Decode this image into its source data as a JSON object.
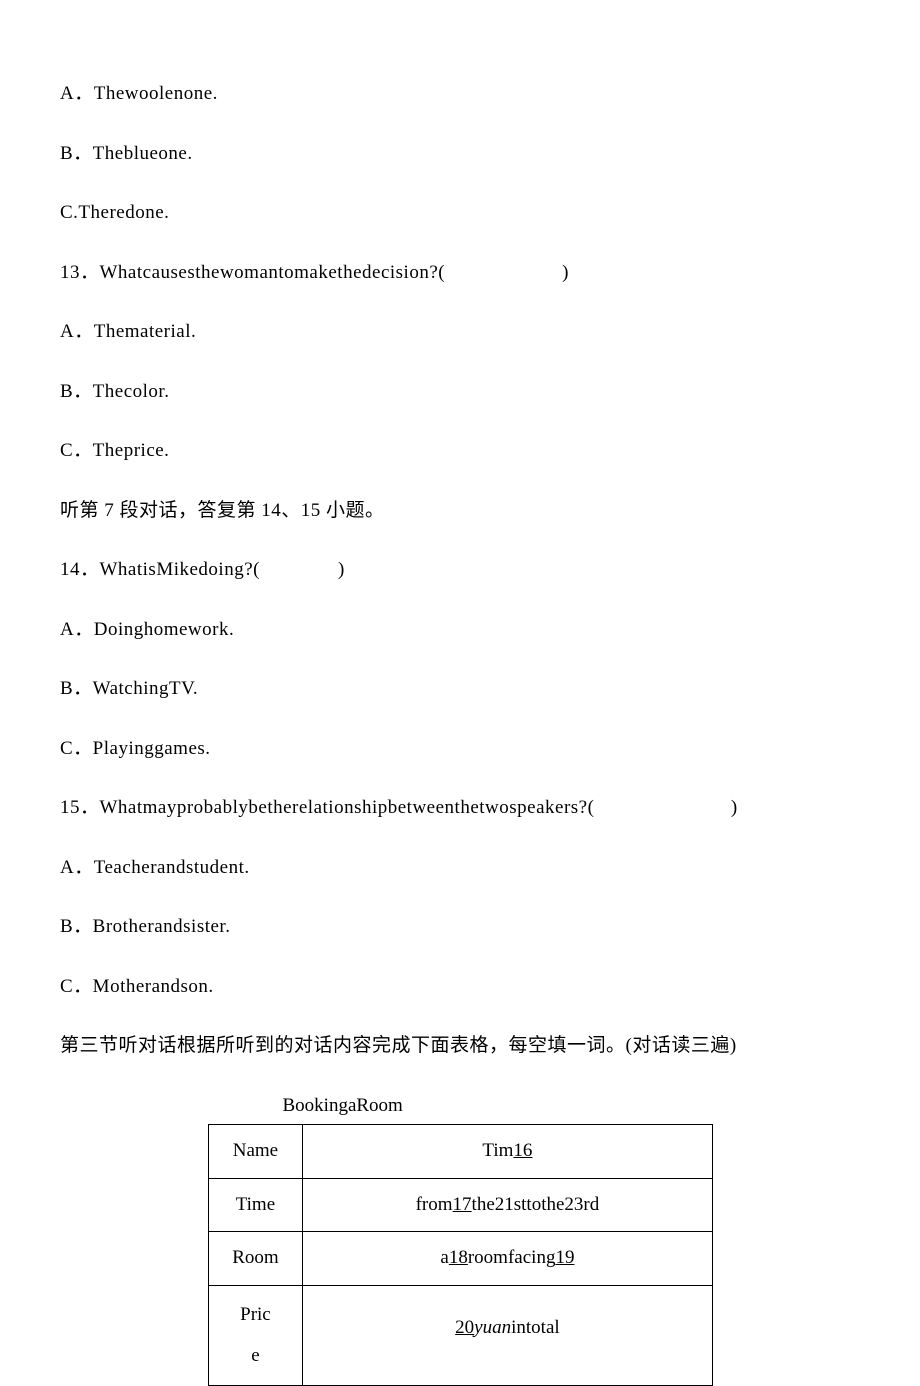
{
  "q12": {
    "optA": "A．Thewoolenone.",
    "optB": "B．Theblueone.",
    "optC": "C.Theredone."
  },
  "q13": {
    "prompt": "13．Whatcausesthewomantomakethedecision?(　　　　　　)",
    "optA": "A．Thematerial.",
    "optB": "B．Thecolor.",
    "optC": "C．Theprice."
  },
  "instruction7": "听第 7 段对话，答复第 14、15 小题。",
  "q14": {
    "prompt": "14．WhatisMikedoing?(　　　　)",
    "optA": "A．Doinghomework.",
    "optB": "B．WatchingTV.",
    "optC": "C．Playinggames."
  },
  "q15": {
    "prompt": "15．Whatmayprobablybetherelationshipbetweenthetwospeakers?(　　　　　　　)",
    "optA": "A．Teacherandstudent.",
    "optB": "B．Brotherandsister.",
    "optC": "C．Motherandson."
  },
  "section3_instruction": "第三节听对话根据所听到的对话内容完成下面表格，每空填一词。(对话读三遍)",
  "table": {
    "title": "BookingaRoom",
    "name_label": "Name",
    "name_prefix": "Tim",
    "name_blank": "16",
    "time_label": "Time",
    "time_prefix": "from",
    "time_blank": "17",
    "time_suffix": "the21sttothe23rd",
    "room_label": "Room",
    "room_prefix": "a",
    "room_blank1": "18",
    "room_mid": "roomfacing",
    "room_blank2": "19",
    "price_label": "Pric\ne",
    "price_blank": "20",
    "price_italic": "yuan",
    "price_suffix": "intotal"
  }
}
